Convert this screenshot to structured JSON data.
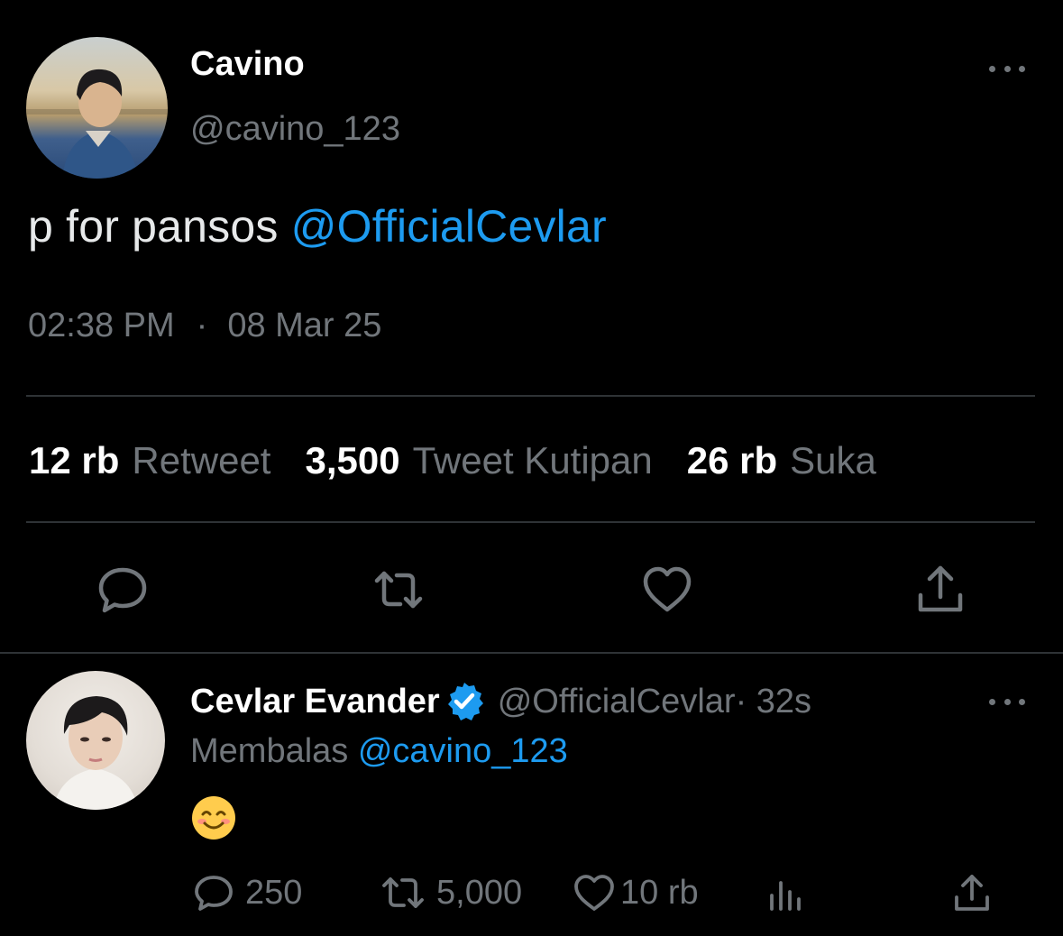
{
  "main_tweet": {
    "author": {
      "display_name": "Cavino",
      "handle": "@cavino_123"
    },
    "text_prefix": "p for pansos ",
    "text_mention": "@OfficialCevlar",
    "time": "02:38 PM",
    "separator": "·",
    "date": "08 Mar 25",
    "stats": {
      "retweets_value": "12 rb",
      "retweets_label": "Retweet",
      "quotes_value": "3,500",
      "quotes_label": "Tweet Kutipan",
      "likes_value": "26 rb",
      "likes_label": "Suka"
    },
    "actions": [
      "reply-icon",
      "retweet-icon",
      "like-icon",
      "share-icon"
    ]
  },
  "reply_tweet": {
    "author": {
      "display_name": "Cevlar Evander",
      "verified": true,
      "handle": "@OfficialCevlar",
      "age": " · 32s"
    },
    "replying_label": "Membalas ",
    "replying_to": "@cavino_123",
    "content_emoji": "smiling-face-with-smiling-eyes",
    "counts": {
      "replies": "250",
      "retweets": "5,000",
      "likes": "10 rb"
    },
    "actions": [
      "reply-icon",
      "retweet-icon",
      "like-icon",
      "analytics-icon",
      "share-icon"
    ]
  },
  "colors": {
    "background": "#000000",
    "text_primary": "#e7e9ea",
    "text_secondary": "#71767b",
    "accent": "#1d9bf0",
    "divider": "#2f3336"
  }
}
